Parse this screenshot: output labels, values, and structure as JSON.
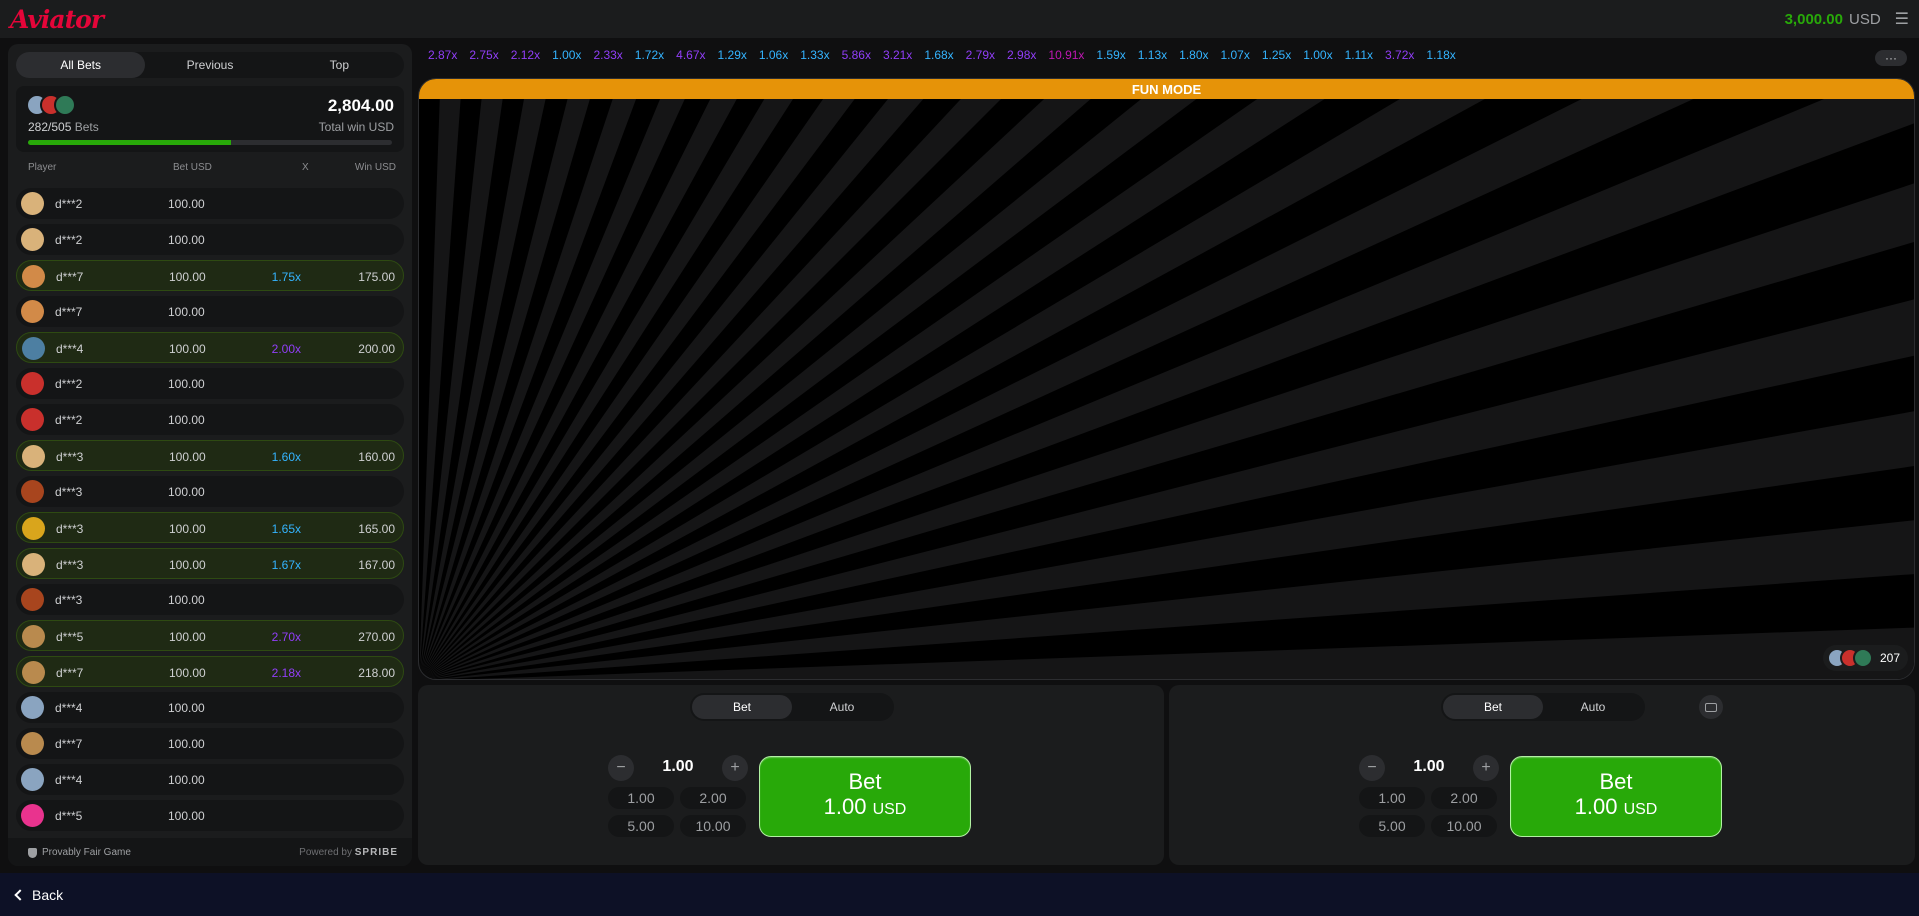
{
  "app": {
    "logo": "Aviator"
  },
  "header": {
    "balance": "3,000.00",
    "currency": "USD"
  },
  "tabs": [
    "All Bets",
    "Previous",
    "Top"
  ],
  "summary": {
    "bets": "282/505",
    "bets_label": "Bets",
    "total_win": "2,804.00",
    "total_win_label": "Total win USD",
    "progress_fraction": 0.558
  },
  "columns": {
    "player": "Player",
    "bet": "Bet USD",
    "x": "X",
    "win": "Win USD"
  },
  "rows": [
    {
      "name": "d***2",
      "bet": "100.00",
      "mult": "",
      "win": "",
      "avatar": "#d9b27a",
      "mult_color": ""
    },
    {
      "name": "d***2",
      "bet": "100.00",
      "mult": "",
      "win": "",
      "avatar": "#d9b27a",
      "mult_color": ""
    },
    {
      "name": "d***7",
      "bet": "100.00",
      "mult": "1.75x",
      "win": "175.00",
      "avatar": "#d28a48",
      "mult_color": "#34b4ff"
    },
    {
      "name": "d***7",
      "bet": "100.00",
      "mult": "",
      "win": "",
      "avatar": "#d28a48",
      "mult_color": ""
    },
    {
      "name": "d***4",
      "bet": "100.00",
      "mult": "2.00x",
      "win": "200.00",
      "avatar": "#4d7fa2",
      "mult_color": "#913ef8"
    },
    {
      "name": "d***2",
      "bet": "100.00",
      "mult": "",
      "win": "",
      "avatar": "#c9302c",
      "mult_color": ""
    },
    {
      "name": "d***2",
      "bet": "100.00",
      "mult": "",
      "win": "",
      "avatar": "#c9302c",
      "mult_color": ""
    },
    {
      "name": "d***3",
      "bet": "100.00",
      "mult": "1.60x",
      "win": "160.00",
      "avatar": "#d9b27a",
      "mult_color": "#34b4ff"
    },
    {
      "name": "d***3",
      "bet": "100.00",
      "mult": "",
      "win": "",
      "avatar": "#a8451e",
      "mult_color": ""
    },
    {
      "name": "d***3",
      "bet": "100.00",
      "mult": "1.65x",
      "win": "165.00",
      "avatar": "#d9a51c",
      "mult_color": "#34b4ff"
    },
    {
      "name": "d***3",
      "bet": "100.00",
      "mult": "1.67x",
      "win": "167.00",
      "avatar": "#d9b27a",
      "mult_color": "#34b4ff"
    },
    {
      "name": "d***3",
      "bet": "100.00",
      "mult": "",
      "win": "",
      "avatar": "#a8451e",
      "mult_color": ""
    },
    {
      "name": "d***5",
      "bet": "100.00",
      "mult": "2.70x",
      "win": "270.00",
      "avatar": "#b98a4e",
      "mult_color": "#913ef8"
    },
    {
      "name": "d***7",
      "bet": "100.00",
      "mult": "2.18x",
      "win": "218.00",
      "avatar": "#b98a4e",
      "mult_color": "#913ef8"
    },
    {
      "name": "d***4",
      "bet": "100.00",
      "mult": "",
      "win": "",
      "avatar": "#8aa4c0",
      "mult_color": ""
    },
    {
      "name": "d***7",
      "bet": "100.00",
      "mult": "",
      "win": "",
      "avatar": "#b98a4e",
      "mult_color": ""
    },
    {
      "name": "d***4",
      "bet": "100.00",
      "mult": "",
      "win": "",
      "avatar": "#8aa4c0",
      "mult_color": ""
    },
    {
      "name": "d***5",
      "bet": "100.00",
      "mult": "",
      "win": "",
      "avatar": "#e9338e",
      "mult_color": ""
    }
  ],
  "footer": {
    "fair": "Provably Fair Game",
    "powered": "Powered by",
    "brand": "SPRIBE"
  },
  "history": [
    {
      "v": "2.87x",
      "c": "#913ef8"
    },
    {
      "v": "2.75x",
      "c": "#913ef8"
    },
    {
      "v": "2.12x",
      "c": "#913ef8"
    },
    {
      "v": "1.00x",
      "c": "#34b4ff"
    },
    {
      "v": "2.33x",
      "c": "#913ef8"
    },
    {
      "v": "1.72x",
      "c": "#34b4ff"
    },
    {
      "v": "4.67x",
      "c": "#913ef8"
    },
    {
      "v": "1.29x",
      "c": "#34b4ff"
    },
    {
      "v": "1.06x",
      "c": "#34b4ff"
    },
    {
      "v": "1.33x",
      "c": "#34b4ff"
    },
    {
      "v": "5.86x",
      "c": "#913ef8"
    },
    {
      "v": "3.21x",
      "c": "#913ef8"
    },
    {
      "v": "1.68x",
      "c": "#34b4ff"
    },
    {
      "v": "2.79x",
      "c": "#913ef8"
    },
    {
      "v": "2.98x",
      "c": "#913ef8"
    },
    {
      "v": "10.91x",
      "c": "#c017b4"
    },
    {
      "v": "1.59x",
      "c": "#34b4ff"
    },
    {
      "v": "1.13x",
      "c": "#34b4ff"
    },
    {
      "v": "1.80x",
      "c": "#34b4ff"
    },
    {
      "v": "1.07x",
      "c": "#34b4ff"
    },
    {
      "v": "1.25x",
      "c": "#34b4ff"
    },
    {
      "v": "1.00x",
      "c": "#34b4ff"
    },
    {
      "v": "1.11x",
      "c": "#34b4ff"
    },
    {
      "v": "3.72x",
      "c": "#913ef8"
    },
    {
      "v": "1.18x",
      "c": "#34b4ff"
    }
  ],
  "history_more": "···",
  "game": {
    "banner": "FUN MODE",
    "players": "207"
  },
  "bet_panels": [
    {
      "tab_bet": "Bet",
      "tab_auto": "Auto",
      "amount": "1.00",
      "quick": [
        "1.00",
        "2.00",
        "5.00",
        "10.00"
      ],
      "btn_label": "Bet",
      "btn_amount": "1.00",
      "btn_currency": "USD"
    },
    {
      "tab_bet": "Bet",
      "tab_auto": "Auto",
      "amount": "1.00",
      "quick": [
        "1.00",
        "2.00",
        "5.00",
        "10.00"
      ],
      "btn_label": "Bet",
      "btn_amount": "1.00",
      "btn_currency": "USD"
    }
  ],
  "nav": {
    "back": "Back"
  },
  "colors": {
    "accent": "#28a909",
    "logo": "#e50539",
    "banner": "#e69308"
  }
}
